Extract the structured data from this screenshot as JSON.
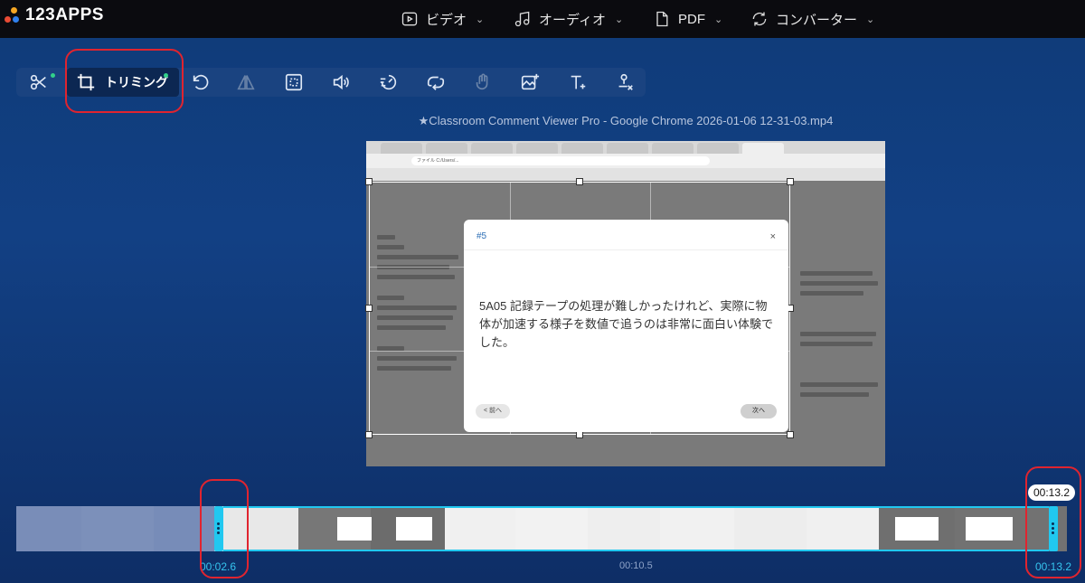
{
  "brand": {
    "name": "123APPS"
  },
  "nav": [
    {
      "label": "ビデオ",
      "icon": "video-icon"
    },
    {
      "label": "オーディオ",
      "icon": "music-note-icon"
    },
    {
      "label": "PDF",
      "icon": "document-icon"
    },
    {
      "label": "コンバーター",
      "icon": "convert-icon"
    }
  ],
  "toolbar": {
    "active_label": "トリミング",
    "tools": [
      "cut-icon",
      "crop-icon",
      "rotate-icon",
      "flip-icon",
      "resize-icon",
      "volume-icon",
      "speed-icon",
      "loop-icon",
      "stabilize-icon",
      "add-image-icon",
      "add-text-icon",
      "remove-logo-icon"
    ]
  },
  "filename": "★Classroom Comment Viewer Pro - Google Chrome 2026-01-06 12-31-03.mp4",
  "video": {
    "addr_text": "ファイル  C:/Users/...",
    "modal": {
      "number": "#5",
      "close": "×",
      "text": "5A05 記録テープの処理が難しかったけれど、実際に物体が加速する様子を数値で追うのは非常に面白い体験でした。",
      "prev": "< 前へ",
      "next": "次へ"
    }
  },
  "timeline": {
    "start_time": "00:02.6",
    "mid_time": "00:10.5",
    "end_time": "00:13.2",
    "tooltip": "00:13.2"
  },
  "colors": {
    "accent": "#21c8f0",
    "highlight": "#e0242f",
    "active_dot": "#32d18a"
  }
}
